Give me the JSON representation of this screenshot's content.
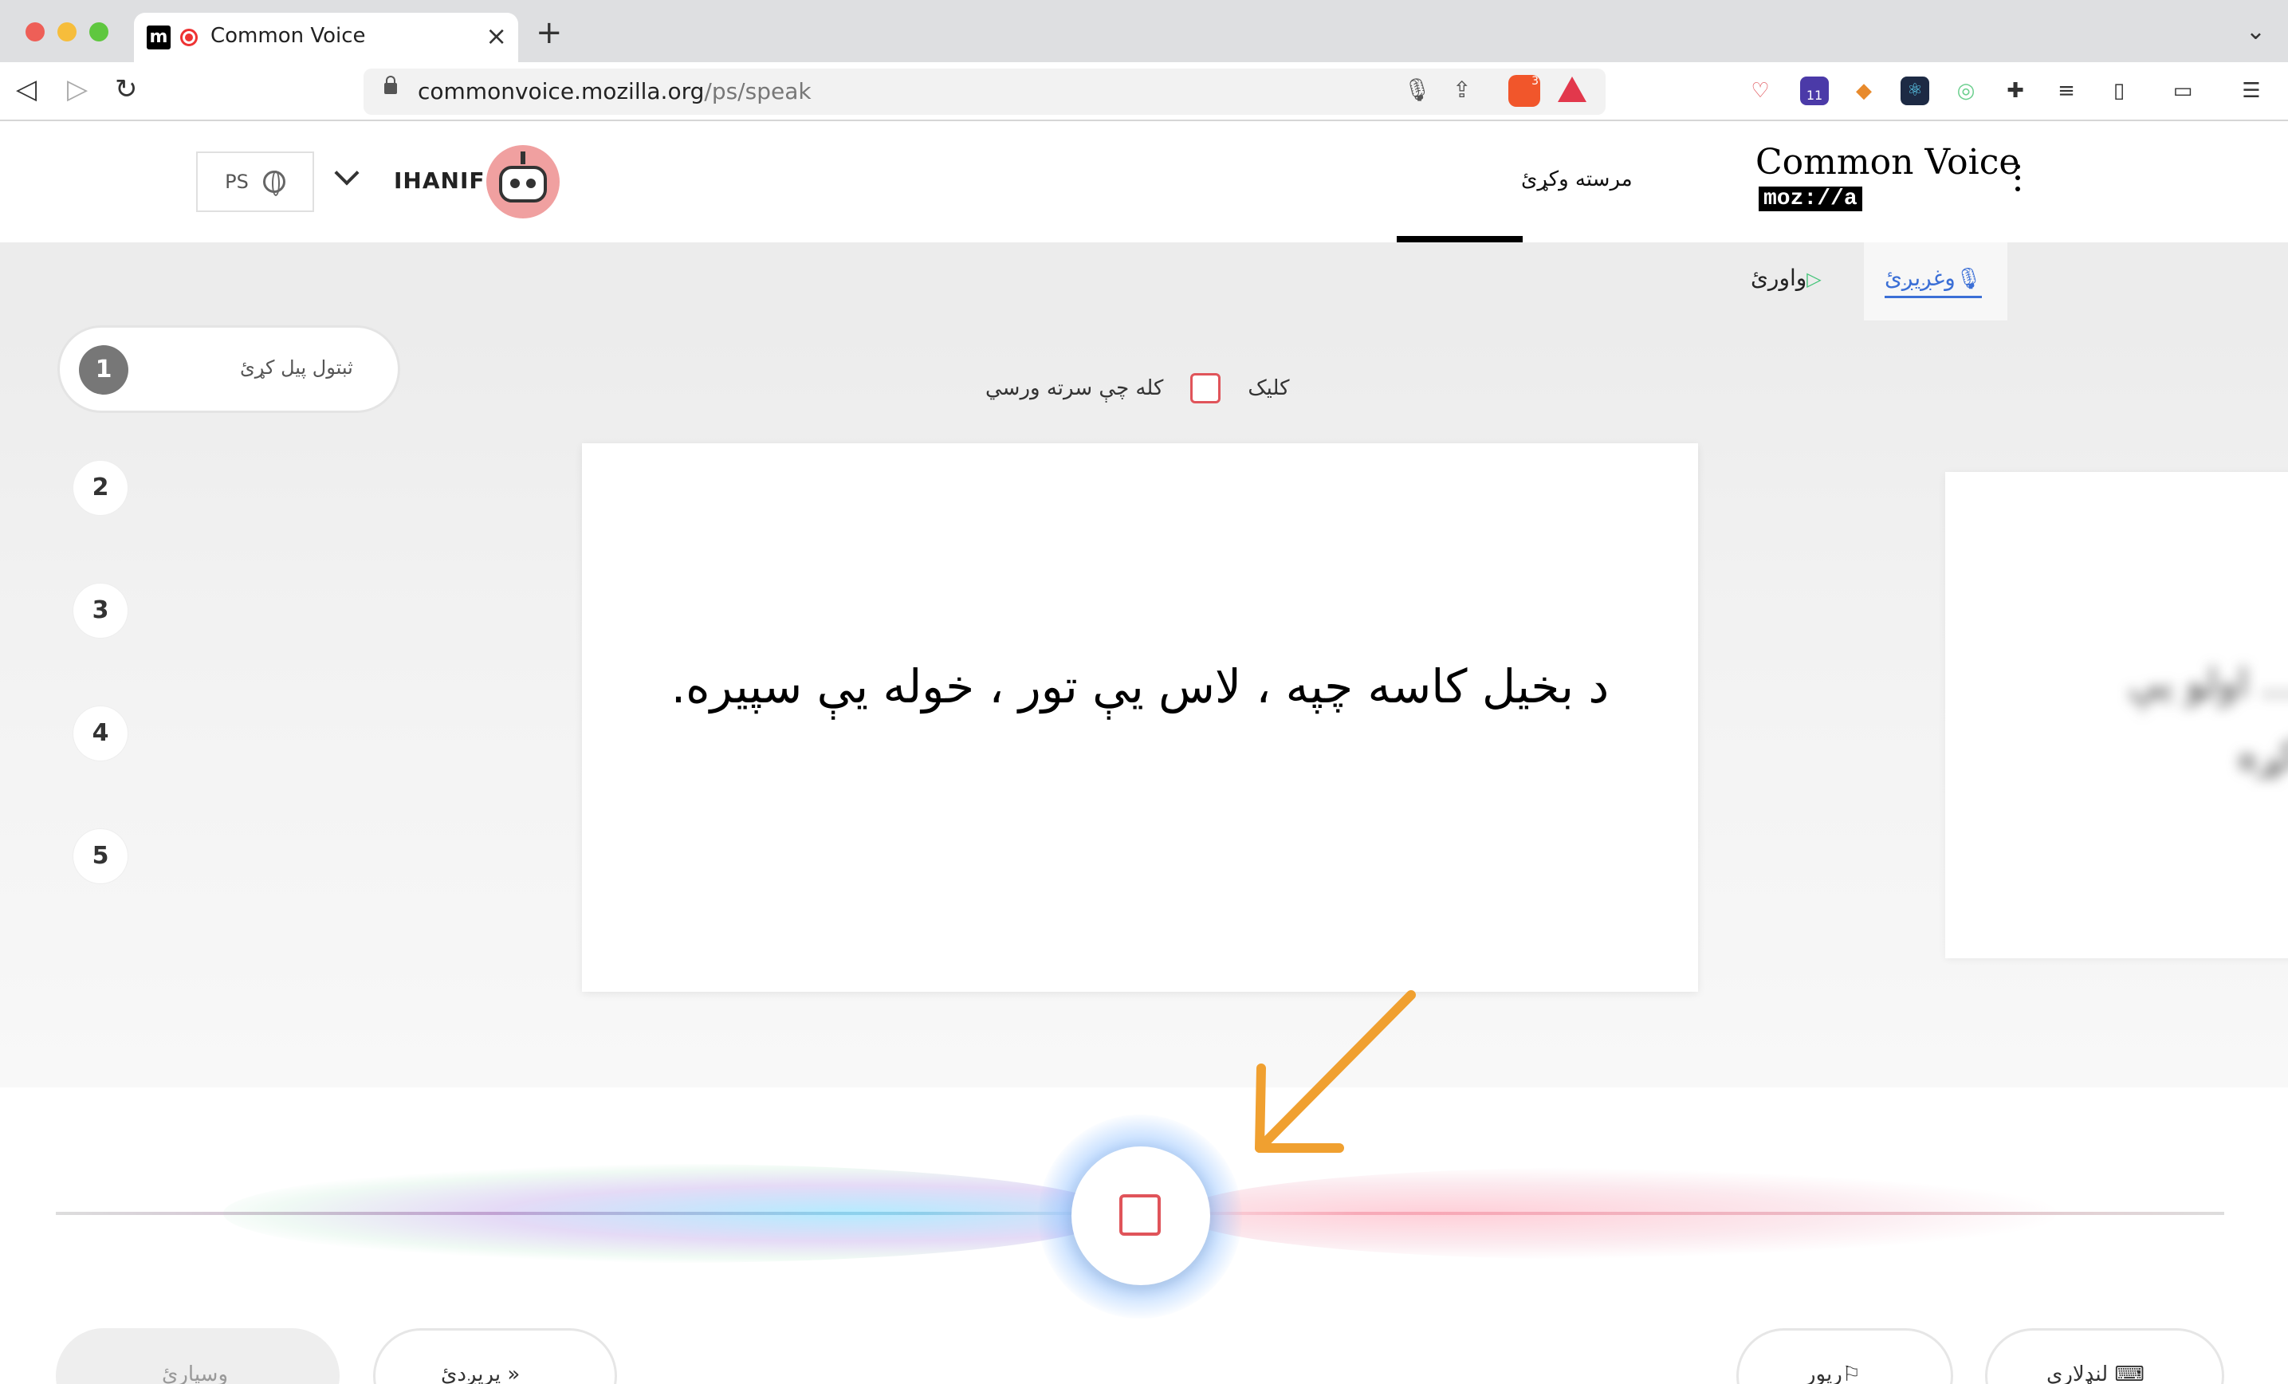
{
  "browser": {
    "tab_title": "Common Voice",
    "tab_favicon": "m",
    "new_tab": "+",
    "tab_close": "×",
    "url_domain": "commonvoice.mozilla.org",
    "url_path": "/ps/speak",
    "brave_count": "3",
    "ext_badge": "11"
  },
  "header": {
    "language": "PS",
    "username": "IHANIF",
    "nav_contribute": "مرسته وکړئ",
    "logo_text": "Common Voice",
    "logo_sub": "moz://a"
  },
  "subnav": {
    "speak": "وغږیږئ",
    "listen": "واورئ"
  },
  "steps": {
    "active_label": "ثبتول پیل کړئ",
    "items": [
      "1",
      "2",
      "3",
      "4",
      "5"
    ]
  },
  "skip": {
    "left_text": "کله چې سرته ورسي",
    "right_text": "کلیک"
  },
  "sentence": "د بخیل کاسه چپه ، لاس یې تور ، خوله یې سپیره.",
  "next_sentence_blurred": "... اولو یې\nکړه",
  "buttons": {
    "submit": "وسپارئ",
    "skip": "پریږدئ",
    "report": "رپور",
    "shortcuts": "لنډلاري"
  },
  "colors": {
    "accent_blue": "#3b6fd6",
    "record_red": "#e0545a",
    "arrow_orange": "#f0a030"
  }
}
